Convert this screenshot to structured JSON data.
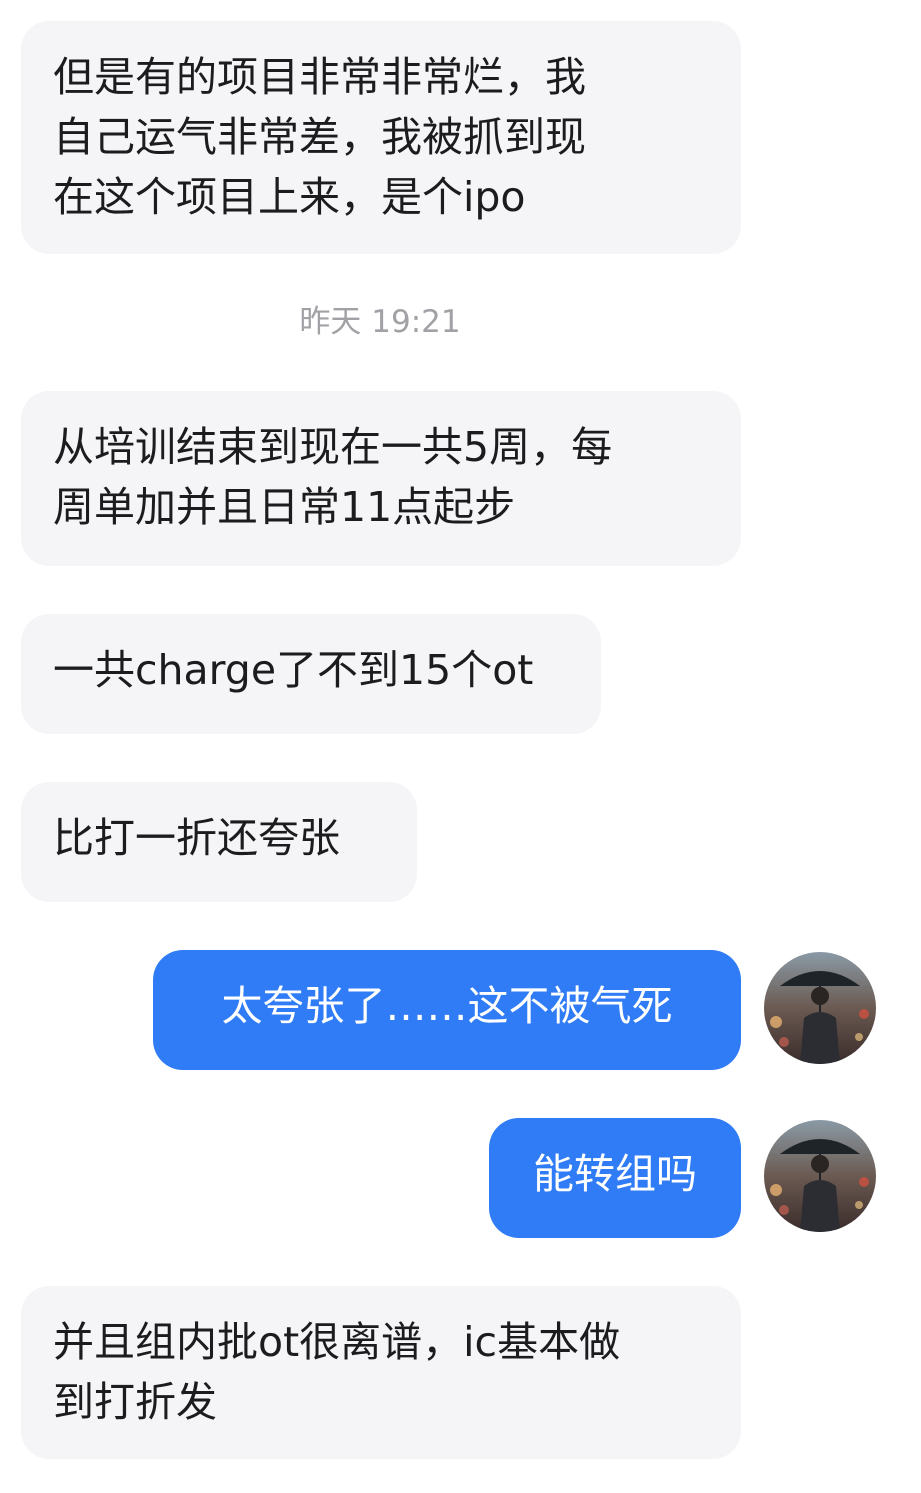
{
  "messages": [
    {
      "direction": "incoming",
      "text": "但是有的项目非常非常烂，我\n自己运气非常差，我被抓到现\n在这个项目上来，是个ipo"
    },
    {
      "direction": "incoming",
      "text": "从培训结束到现在一共5周，每\n周单加并且日常11点起步"
    },
    {
      "direction": "incoming",
      "text": "一共charge了不到15个ot"
    },
    {
      "direction": "incoming",
      "text": "比打一折还夸张"
    },
    {
      "direction": "outgoing",
      "text": "太夸张了……这不被气死"
    },
    {
      "direction": "outgoing",
      "text": "能转组吗"
    },
    {
      "direction": "incoming",
      "text": "并且组内批ot很离谱，ic基本做\n到打折发"
    }
  ],
  "timestamp": "昨天 19:21",
  "colors": {
    "incoming_bubble": "#f5f5f7",
    "outgoing_bubble": "#2f7cf6",
    "timestamp_text": "#a2a2a6"
  },
  "avatar_icon": "man-with-umbrella-avatar"
}
